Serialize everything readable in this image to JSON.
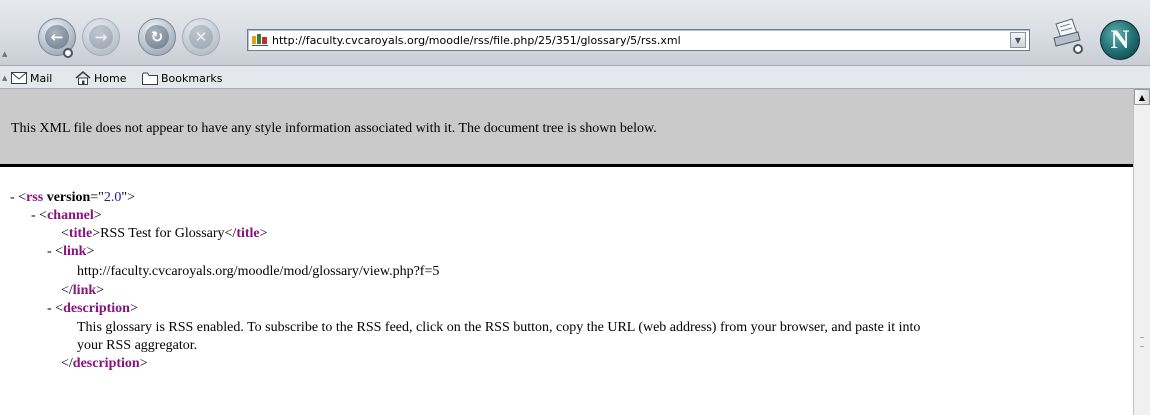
{
  "toolbar": {
    "url": "http://faculty.cvcaroyals.org/moodle/rss/file.php/25/351/glossary/5/rss.xml",
    "throbber_letter": "N"
  },
  "personal_toolbar": {
    "items": [
      {
        "label": "Mail",
        "icon": "mail-icon"
      },
      {
        "label": "Home",
        "icon": "home-icon"
      },
      {
        "label": "Bookmarks",
        "icon": "bookmarks-folder-icon"
      }
    ]
  },
  "notice": "This XML file does not appear to have any style information associated with it. The document tree is shown below.",
  "xml": {
    "rss_tag": "rss",
    "version_attr": "version",
    "version_value": "2.0",
    "channel_tag": "channel",
    "title_tag": "title",
    "title_text": "RSS Test for Glossary",
    "link_tag": "link",
    "link_text": "http://faculty.cvcaroyals.org/moodle/mod/glossary/view.php?f=5",
    "description_tag": "description",
    "description_line1": "This glossary is RSS enabled. To subscribe to the RSS feed, click on the RSS button, copy the URL (web address) from your browser, and paste it into",
    "description_line2": "your RSS aggregator.",
    "collapse_marker": "-"
  },
  "colors": {
    "tag": "#881280",
    "attribute_value": "#1a1aa6",
    "notice_background": "#cacaca"
  }
}
